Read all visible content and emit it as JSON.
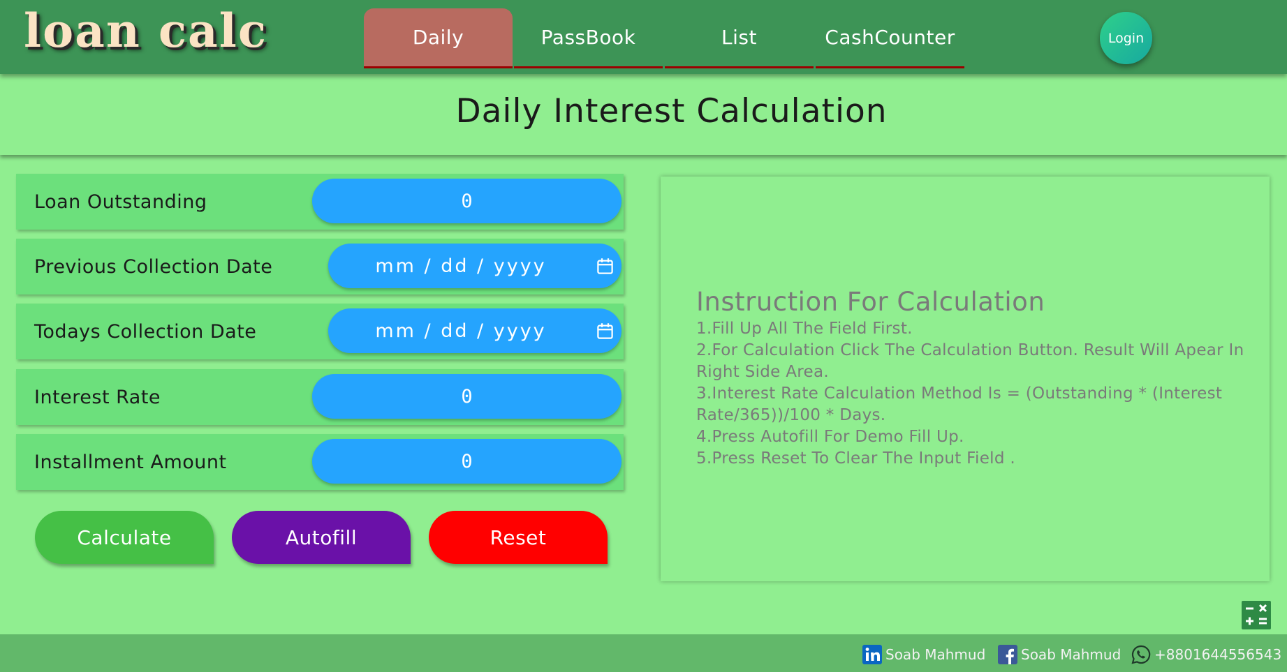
{
  "header": {
    "logo_text": "loan calc",
    "nav": [
      {
        "label": "Daily",
        "active": true
      },
      {
        "label": "PassBook",
        "active": false
      },
      {
        "label": "List",
        "active": false
      },
      {
        "label": "CashCounter",
        "active": false
      }
    ],
    "login_label": "Login"
  },
  "page": {
    "title": "Daily Interest Calculation"
  },
  "form": {
    "loan_outstanding": {
      "label": "Loan Outstanding",
      "value": "0"
    },
    "previous_date": {
      "label": "Previous Collection Date",
      "placeholder": "mm / dd / yyyy"
    },
    "todays_date": {
      "label": "Todays Collection Date",
      "placeholder": "mm / dd / yyyy"
    },
    "interest_rate": {
      "label": "Interest Rate",
      "value": "0"
    },
    "installment_amount": {
      "label": "Installment Amount",
      "value": "0"
    }
  },
  "buttons": {
    "calculate": "Calculate",
    "autofill": "Autofill",
    "reset": "Reset"
  },
  "instructions": {
    "heading": "Instruction For Calculation",
    "items": [
      "1.Fill Up All The Field First.",
      "2.For Calculation Click The Calculation Button. Result Will Apear In Right Side Area.",
      "3.Interest Rate Calculation Method Is = (Outstanding * (Interest Rate/365))/100 * Days.",
      "4.Press Autofill For Demo Fill Up.",
      "5.Press Reset To Clear The Input Field ."
    ]
  },
  "footer": {
    "linkedin": "Soab Mahmud",
    "facebook": "Soab Mahmud",
    "whatsapp": "+8801644556543"
  },
  "colors": {
    "background": "#90ee90",
    "header": "#3d9456",
    "active_tab": "#b86b60",
    "input": "#25a4fe",
    "calculate": "#45c046",
    "autofill": "#6a11a8",
    "reset": "#ff0000",
    "footer": "#62b86a"
  },
  "icons": [
    "calendar-icon",
    "calculator-icon",
    "linkedin-icon",
    "facebook-icon",
    "whatsapp-icon"
  ]
}
